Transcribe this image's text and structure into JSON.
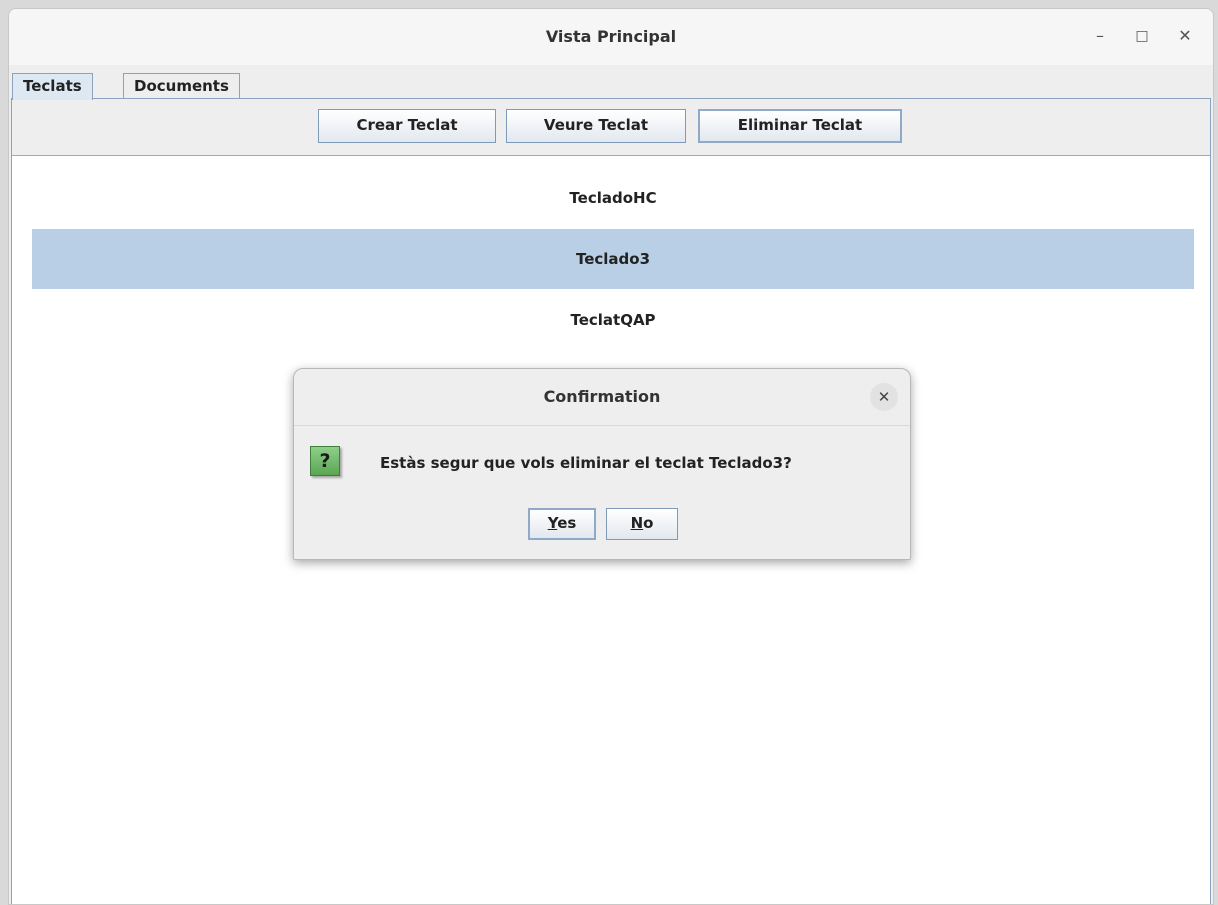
{
  "window": {
    "title": "Vista Principal",
    "minimize_glyph": "–",
    "maximize_glyph": "□",
    "close_glyph": "✕"
  },
  "tabs": [
    {
      "label": "Teclats",
      "active": true
    },
    {
      "label": "Documents",
      "active": false
    }
  ],
  "toolbar": {
    "create_label": "Crear Teclat",
    "view_label": "Veure Teclat",
    "delete_label": "Eliminar Teclat"
  },
  "keyboard_list": {
    "items": [
      {
        "label": "TecladoHC",
        "selected": false
      },
      {
        "label": "Teclado3",
        "selected": true
      },
      {
        "label": "TeclatQAP",
        "selected": false
      }
    ]
  },
  "dialog": {
    "title": "Confirmation",
    "close_glyph": "✕",
    "icon": "question-icon",
    "icon_glyph": "?",
    "message": "Estàs segur que vols eliminar el teclat Teclado3?",
    "yes_mnemonic": "Y",
    "yes_rest": "es",
    "no_mnemonic": "N",
    "no_rest": "o"
  },
  "colors": {
    "selection": "#b8cfe5",
    "button_border": "#7f9ab8",
    "icon_green": "#5aa653"
  }
}
